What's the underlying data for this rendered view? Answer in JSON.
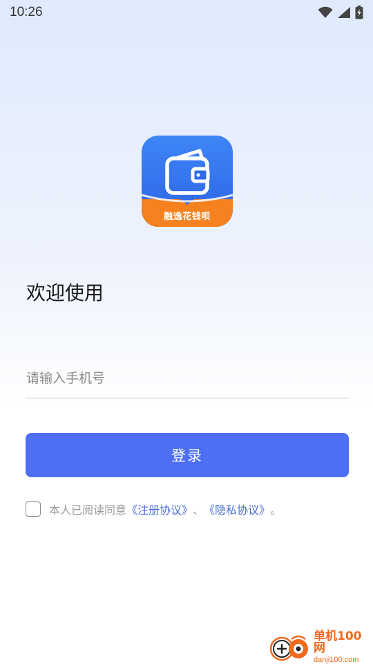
{
  "status_bar": {
    "time": "10:26",
    "icons": [
      "wifi-icon",
      "cellular-signal-icon",
      "battery-charging-icon"
    ]
  },
  "app": {
    "logo_text": "融逸花钱呗",
    "logo_icon": "wallet-icon",
    "colors": {
      "logo_blue": "#2a62e4",
      "logo_orange": "#f5821f",
      "accent": "#4e6ff4"
    }
  },
  "login": {
    "welcome_title": "欢迎使用",
    "phone_placeholder": "请输入手机号",
    "phone_value": "",
    "login_button_label": "登录"
  },
  "agreement": {
    "prefix": "本人已阅读同意",
    "register_link": "《注册协议》",
    "separator": "、",
    "privacy_link": "《隐私协议》",
    "suffix": "。",
    "checked": false
  },
  "watermark": {
    "name": "单机100网",
    "domain": "danji100.com"
  }
}
